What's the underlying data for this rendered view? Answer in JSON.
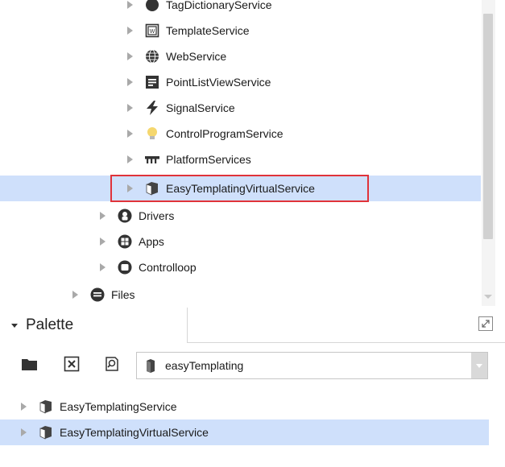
{
  "tree": {
    "items": [
      {
        "label": "TagDictionaryService",
        "icon": "tag-dictionary-icon",
        "selected": false
      },
      {
        "label": "TemplateService",
        "icon": "template-icon",
        "selected": false
      },
      {
        "label": "WebService",
        "icon": "globe-icon",
        "selected": false
      },
      {
        "label": "PointListViewService",
        "icon": "list-view-icon",
        "selected": false
      },
      {
        "label": "SignalService",
        "icon": "lightning-icon",
        "selected": false
      },
      {
        "label": "ControlProgramService",
        "icon": "lightbulb-icon",
        "selected": false
      },
      {
        "label": "PlatformServices",
        "icon": "platform-icon",
        "selected": false
      },
      {
        "label": "EasyTemplatingVirtualService",
        "icon": "cube-icon",
        "selected": true
      },
      {
        "label": "Drivers",
        "icon": "drivers-icon",
        "selected": false
      },
      {
        "label": "Apps",
        "icon": "apps-icon",
        "selected": false
      },
      {
        "label": "Controlloop",
        "icon": "controlloop-icon",
        "selected": false
      },
      {
        "label": "Files",
        "icon": "files-icon",
        "selected": false
      }
    ]
  },
  "palette": {
    "title": "Palette",
    "module_value": "easyTemplating",
    "items": [
      {
        "label": "EasyTemplatingService",
        "icon": "cube-icon",
        "selected": false
      },
      {
        "label": "EasyTemplatingVirtualService",
        "icon": "cube-icon",
        "selected": true
      }
    ]
  },
  "colors": {
    "selection": "#cfe0fb",
    "highlight_border": "#e0333a"
  }
}
